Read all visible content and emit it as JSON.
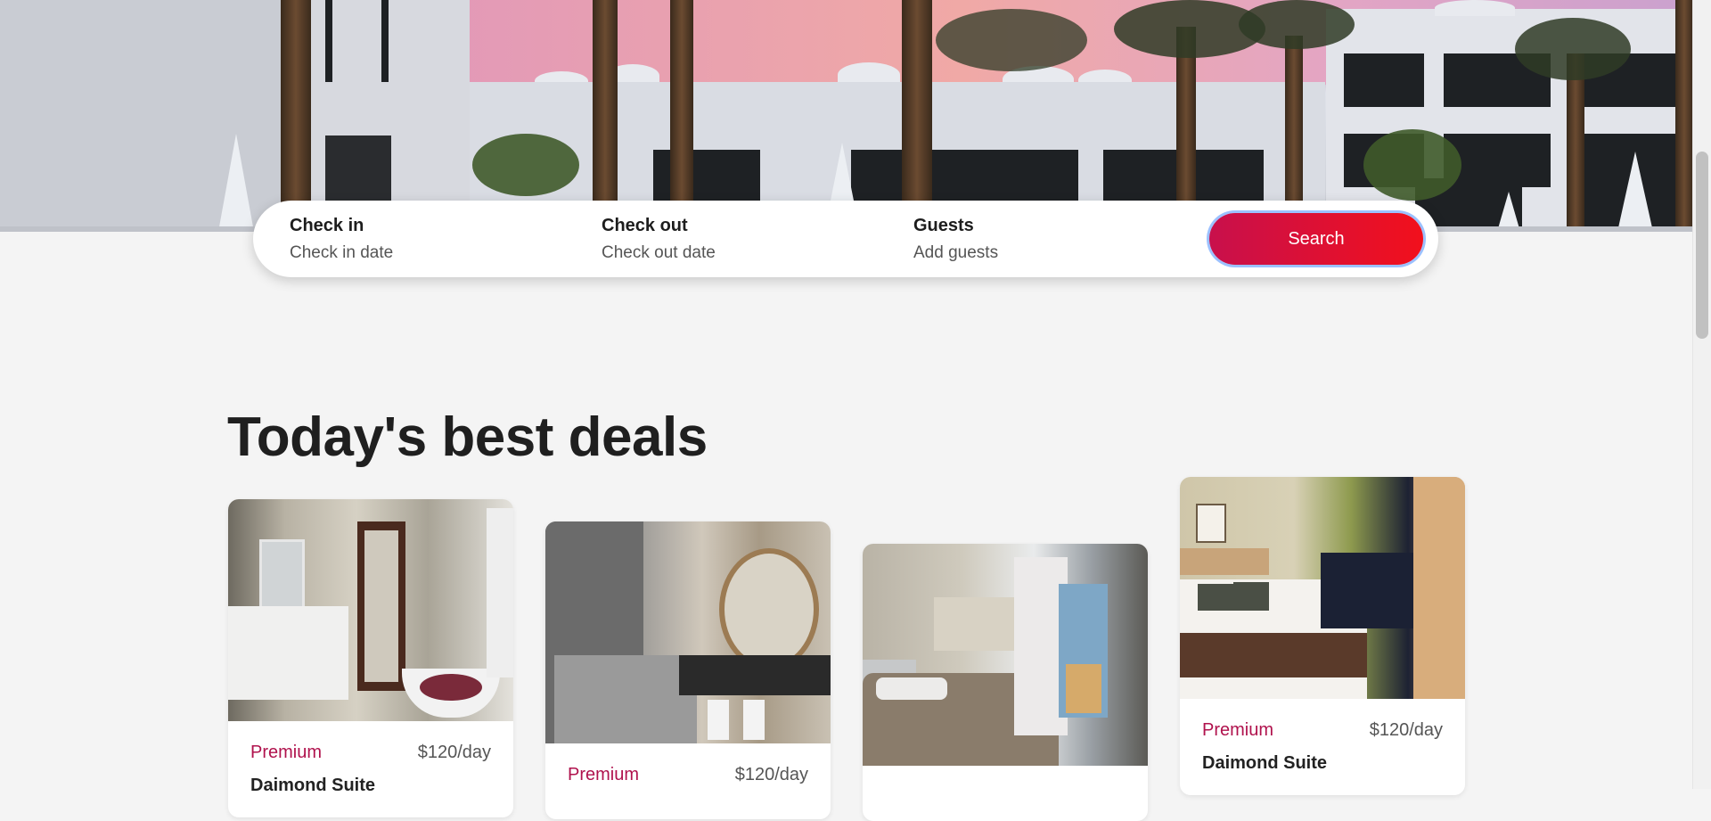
{
  "search": {
    "check_in": {
      "label": "Check in",
      "placeholder": "Check in date"
    },
    "check_out": {
      "label": "Check out",
      "placeholder": "Check out date"
    },
    "guests": {
      "label": "Guests",
      "placeholder": "Add guests"
    },
    "button_label": "Search"
  },
  "deals": {
    "title": "Today's best deals",
    "cards": [
      {
        "tier": "Premium",
        "price": "$120/day",
        "name": "Daimond Suite"
      },
      {
        "tier": "Premium",
        "price": "$120/day",
        "name": ""
      },
      {
        "tier": "",
        "price": "",
        "name": ""
      },
      {
        "tier": "Premium",
        "price": "$120/day",
        "name": "Daimond Suite"
      }
    ]
  },
  "colors": {
    "accent": "#b0124d",
    "button_start": "#c8104c",
    "button_end": "#f2101c",
    "background": "#f4f4f4"
  },
  "icons": []
}
